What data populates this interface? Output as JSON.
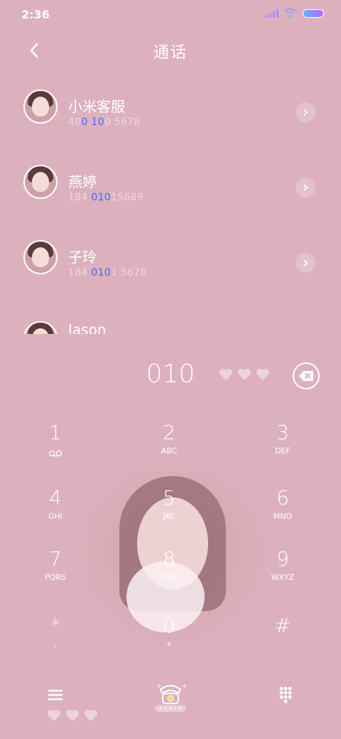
{
  "status_bar": {
    "time": "2:36",
    "icons": [
      "signal-icon",
      "wifi-icon",
      "battery-icon"
    ]
  },
  "header": {
    "title": "通话",
    "back_icon": "chevron-left-icon"
  },
  "contacts": [
    {
      "name": "小米客服",
      "number_parts": [
        "40",
        "0",
        " ",
        "10",
        "0 5678"
      ]
    },
    {
      "name": "燕婷",
      "number_parts": [
        "184 ",
        "",
        "",
        "010",
        "15689"
      ]
    },
    {
      "name": "子玲",
      "number_parts": [
        "184 ",
        "",
        "",
        "010",
        "1 5678"
      ]
    },
    {
      "name": "Jason",
      "number_parts": [
        "",
        "",
        "",
        "",
        ""
      ]
    }
  ],
  "dialer": {
    "number": "010",
    "delete_icon": "backspace-icon"
  },
  "keypad": [
    {
      "digit": "1",
      "letters": "",
      "sub_icon": "voicemail-icon"
    },
    {
      "digit": "2",
      "letters": "ABC"
    },
    {
      "digit": "3",
      "letters": "DEF"
    },
    {
      "digit": "4",
      "letters": "GHI"
    },
    {
      "digit": "5",
      "letters": "JKL"
    },
    {
      "digit": "6",
      "letters": "MNO"
    },
    {
      "digit": "7",
      "letters": "PQRS"
    },
    {
      "digit": "8",
      "letters": "TUV"
    },
    {
      "digit": "9",
      "letters": "WXYZ"
    },
    {
      "digit": "*",
      "letters": ","
    },
    {
      "digit": "0",
      "letters": "+"
    },
    {
      "digit": "#",
      "letters": ""
    }
  ],
  "bottom_bar": {
    "menu_icon": "menu-icon",
    "call_icon": "telephone-icon",
    "call_label": "+++++",
    "keypad_icon": "dialpad-icon"
  },
  "colors": {
    "background": "#dcb1bd",
    "highlight": "#3b68ff",
    "text": "#ffffff"
  }
}
